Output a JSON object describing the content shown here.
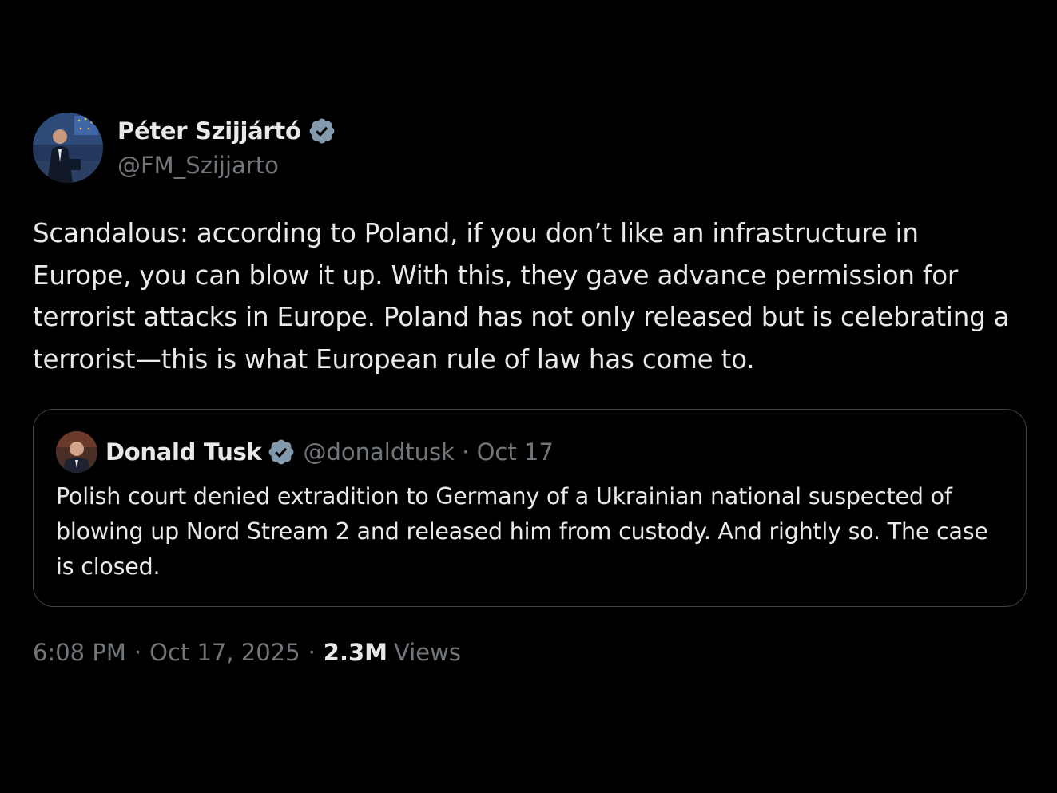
{
  "tweet": {
    "author_name": "Péter Szijjártó",
    "author_handle": "@FM_Szijjarto",
    "text": "Scandalous: according to Poland, if you don’t like an infrastructure in Europe, you can blow it up. With this, they gave advance permission for terrorist attacks in Europe. Poland has not only released but is celebrating a terrorist—this is what European rule of law has come to.",
    "time": "6:08 PM",
    "date": "Oct 17, 2025",
    "separator": "·",
    "views_count": "2.3M",
    "views_label": "Views"
  },
  "quoted": {
    "author_name": "Donald Tusk",
    "meta": "@donaldtusk · Oct 17",
    "text": "Polish court denied extradition to Germany of a Ukrainian national suspected of blowing up Nord Stream 2 and released him from custody. And rightly so. The case is closed."
  },
  "icons": {
    "verified": "verified-badge-icon"
  },
  "colors": {
    "background": "#000000",
    "text_primary": "#e7e9ea",
    "text_secondary": "#71767b",
    "border": "#3e4144",
    "badge_fill": "#829aab"
  }
}
